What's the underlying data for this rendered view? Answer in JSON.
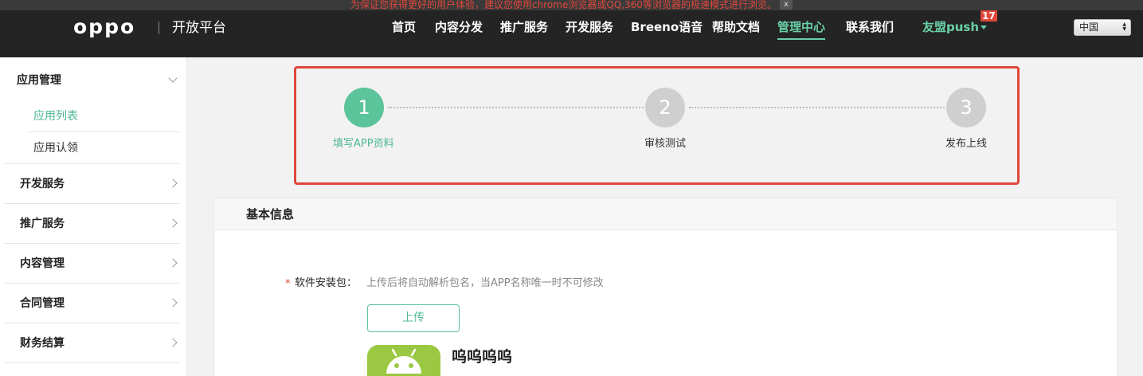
{
  "notice": {
    "text": "为保证您获得更好的用户体验，建议您使用chrome浏览器或QQ,360等浏览器的极速模式进行浏览。",
    "close_label": "x"
  },
  "header": {
    "logo": "oppo",
    "subtitle": "开放平台",
    "nav": [
      {
        "label": "首页",
        "active": false
      },
      {
        "label": "内容分发",
        "active": false
      },
      {
        "label": "推广服务",
        "active": false
      },
      {
        "label": "开发服务",
        "active": false
      },
      {
        "label": "Breeno语音",
        "active": false
      },
      {
        "label": "帮助文档",
        "active": false
      },
      {
        "label": "管理中心",
        "active": true
      },
      {
        "label": "联系我们",
        "active": false
      }
    ],
    "user": "友盟push",
    "badge_count": "17",
    "region": "中国"
  },
  "sidebar": {
    "groups": [
      {
        "title": "应用管理",
        "expanded": true,
        "items": [
          {
            "label": "应用列表",
            "active": true
          },
          {
            "label": "应用认领",
            "active": false
          }
        ]
      },
      {
        "title": "开发服务",
        "expanded": false
      },
      {
        "title": "推广服务",
        "expanded": false
      },
      {
        "title": "内容管理",
        "expanded": false
      },
      {
        "title": "合同管理",
        "expanded": false
      },
      {
        "title": "财务结算",
        "expanded": false
      }
    ]
  },
  "stepper": {
    "steps": [
      {
        "number": "1",
        "label": "填写APP资料",
        "active": true
      },
      {
        "number": "2",
        "label": "审核测试",
        "active": false
      },
      {
        "number": "3",
        "label": "发布上线",
        "active": false
      }
    ]
  },
  "form": {
    "section_title": "基本信息",
    "required_mark": "*",
    "package_label": "软件安装包：",
    "package_hint": "上传后将自动解析包名，当APP名称唯一时不可修改",
    "upload_label": "上传",
    "app_name": "呜呜呜呜"
  },
  "colors": {
    "accent": "#5cc49a",
    "alert": "#e0473b",
    "header_bg": "#242424",
    "android_green": "#9bc843"
  }
}
